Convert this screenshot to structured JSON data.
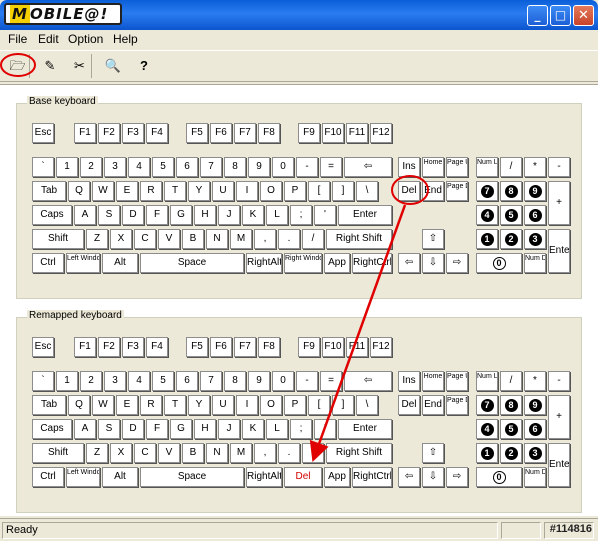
{
  "window": {
    "title_logo_m": "M",
    "title_logo_rest": "OBILE@!",
    "min_label": "_",
    "max_label": "□",
    "close_label": "✕"
  },
  "menu": [
    "File",
    "Edit",
    "Option",
    "Help"
  ],
  "toolbar": {
    "icons": [
      "open-file-icon",
      "apply-icon",
      "reset-icon",
      "view-icon",
      "help-icon"
    ],
    "glyphs": [
      "🗁",
      "✎",
      "✂",
      "🔍",
      "?"
    ]
  },
  "base": {
    "title": "Base keyboard"
  },
  "remapped": {
    "title": "Remapped keyboard"
  },
  "keys": {
    "esc": "Esc",
    "f": [
      "F1",
      "F2",
      "F3",
      "F4",
      "F5",
      "F6",
      "F7",
      "F8",
      "F9",
      "F10",
      "F11",
      "F12"
    ],
    "row1": [
      "`",
      "1",
      "2",
      "3",
      "4",
      "5",
      "6",
      "7",
      "8",
      "9",
      "0",
      "-",
      "="
    ],
    "backspace": "⇦",
    "tab": "Tab",
    "row2": [
      "Q",
      "W",
      "E",
      "R",
      "T",
      "Y",
      "U",
      "I",
      "O",
      "P",
      "[",
      "]",
      "\\"
    ],
    "caps": "Caps",
    "row3": [
      "A",
      "S",
      "D",
      "F",
      "G",
      "H",
      "J",
      "K",
      "L",
      ";",
      "'"
    ],
    "enter": "Enter",
    "shift": "Shift",
    "row4": [
      "Z",
      "X",
      "C",
      "V",
      "B",
      "N",
      "M",
      ",",
      ".",
      "/"
    ],
    "rshift": "Right Shift",
    "ctrl": "Ctrl",
    "lwin": "Left Windows",
    "alt": "Alt",
    "space": "Space",
    "ralt": "RightAlt",
    "rwin": "Right Windows",
    "app": "App",
    "rctrl": "RightCtrl",
    "ins": "Ins",
    "home": "Home",
    "pgup": "Page Up",
    "del": "Del",
    "end": "End",
    "pgdn": "Page Down",
    "up": "⇧",
    "left": "⇦",
    "down": "⇩",
    "right": "⇨",
    "numlock": "Num Lock",
    "slash": "/",
    "star": "*",
    "minus": "-",
    "n7": "7",
    "n8": "8",
    "n9": "9",
    "n4": "4",
    "n5": "5",
    "n6": "6",
    "n1": "1",
    "n2": "2",
    "n3": "3",
    "n0": "0",
    "plus": "+",
    "numdel": "Num Del",
    "numenter": "Enter"
  },
  "remap": {
    "rwin": "Del"
  },
  "status": {
    "text": "Ready",
    "watermark": "#114816"
  },
  "colors": {
    "highlight": "#e00000",
    "title": "#0a5fd8",
    "face": "#ece9d8"
  }
}
